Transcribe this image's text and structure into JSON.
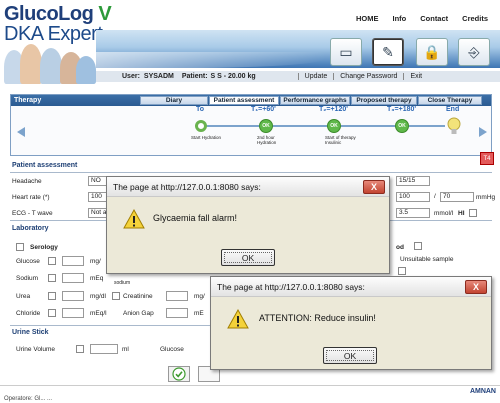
{
  "header": {
    "logo_line1": "GlucoLog",
    "logo_v": "V",
    "logo_line2": "DKA Expert",
    "nav": [
      "HOME",
      "Info",
      "Contact",
      "Credits"
    ]
  },
  "userbar": {
    "user_label": "User:",
    "user_value": "SYSADM",
    "patient_label": "Patient:",
    "patient_value": "S S - 20.00 kg",
    "links": [
      "Update",
      "Change Password",
      "Exit"
    ]
  },
  "therapy": {
    "title": "Therapy",
    "tabs": [
      "Diary",
      "Patient assessment",
      "Performance graphs",
      "Proposed therapy",
      "Close Therapy"
    ],
    "active_tab": "Patient assessment",
    "nodes": [
      {
        "time": "To",
        "label": "",
        "sub": "Start Hydration"
      },
      {
        "time": "T₁=+60'",
        "label": "OK",
        "sub": "2nd hour Hydration"
      },
      {
        "time": "T₂=+120'",
        "label": "OK",
        "sub": "Start of therapy Insulinic"
      },
      {
        "time": "T₃=+180'",
        "label": "OK",
        "sub": ""
      },
      {
        "time": "End",
        "label": "",
        "sub": ""
      }
    ]
  },
  "assessment": {
    "title": "Patient assessment",
    "badge": "T4",
    "headache_label": "Headache",
    "headache_value": "NO",
    "heart_label": "Heart rate (*)",
    "heart_value": "100",
    "ecg_label": "ECG - T wave",
    "ecg_value": "Not a",
    "gcs_value": "15/15",
    "bp_sys": "100",
    "bp_sep": "/",
    "bp_dia": "70",
    "bp_unit": "mmHg",
    "k_value": "3.5",
    "k_unit": "mmol/l",
    "hi_label": "HI"
  },
  "laboratory": {
    "title": "Laboratory",
    "serology": "Serology",
    "rows": [
      {
        "label": "Glucose",
        "unit": "mg/"
      },
      {
        "label": "Sodium",
        "unit": "mEq"
      },
      {
        "label": "Urea",
        "unit": "mg/dl"
      },
      {
        "label": "Chloride",
        "unit": "mEq/l"
      }
    ],
    "col2_label_sodium": "sodium",
    "col2_creatinine": "Creatinine",
    "col2_anion": "Anion Gap",
    "col2_unit_urea": "mg/",
    "col2_unit_chloride": "mE",
    "blood_suffix": "od",
    "unsuitable": "Unsuitable sample"
  },
  "urine": {
    "title": "Urine Stick",
    "volume_label": "Urine Volume",
    "volume_unit": "ml",
    "glucose_label": "Glucose"
  },
  "footer": {
    "left": "Operatore: Gl... ...",
    "brand": "AMNAN"
  },
  "dialog1": {
    "title": "The page at http://127.0.0.1:8080 says:",
    "message": "Glycaemia fall alarm!",
    "ok": "OK",
    "close": "X"
  },
  "dialog2": {
    "title": "The page at http://127.0.0.1:8080 says:",
    "message": "ATTENTION: Reduce insulin!",
    "ok": "OK",
    "close": "X"
  }
}
